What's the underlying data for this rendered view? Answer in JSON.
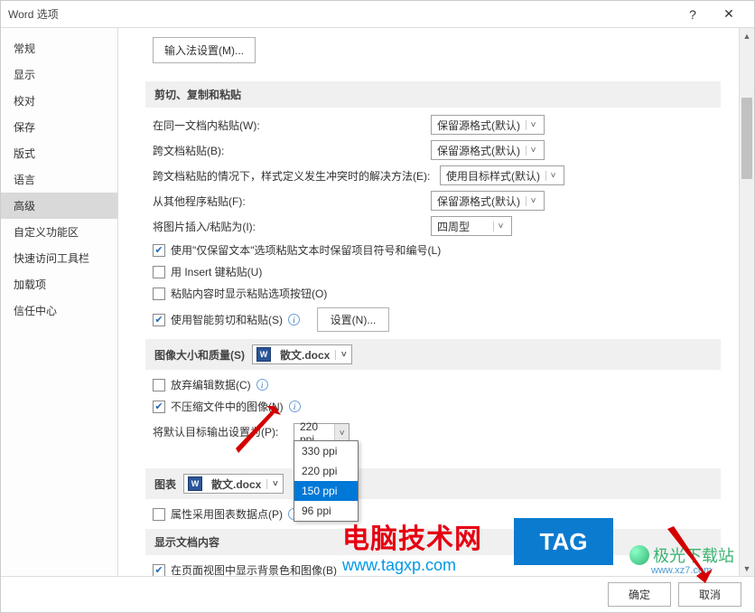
{
  "titlebar": {
    "title": "Word 选项",
    "help": "?",
    "close": "✕"
  },
  "sidebar": {
    "items": [
      {
        "label": "常规"
      },
      {
        "label": "显示"
      },
      {
        "label": "校对"
      },
      {
        "label": "保存"
      },
      {
        "label": "版式"
      },
      {
        "label": "语言"
      },
      {
        "label": "高级",
        "selected": true
      },
      {
        "label": "自定义功能区"
      },
      {
        "label": "快速访问工具栏"
      },
      {
        "label": "加载项"
      },
      {
        "label": "信任中心"
      }
    ]
  },
  "content": {
    "ime_btn": "输入法设置(M)...",
    "section_cut": "剪切、复制和粘贴",
    "paste_same_label": "在同一文档内粘贴(W):",
    "paste_same_value": "保留源格式(默认)",
    "paste_cross_label": "跨文档粘贴(B):",
    "paste_cross_value": "保留源格式(默认)",
    "paste_conflict_label": "跨文档粘贴的情况下，样式定义发生冲突时的解决方法(E):",
    "paste_conflict_value": "使用目标样式(默认)",
    "paste_other_label": "从其他程序粘贴(F):",
    "paste_other_value": "保留源格式(默认)",
    "paste_img_label": "将图片插入/粘贴为(I):",
    "paste_img_value": "四周型",
    "cb_keep_bullets": "使用\"仅保留文本\"选项粘贴文本时保留项目符号和编号(L)",
    "cb_insert_key": "用 Insert 键粘贴(U)",
    "cb_show_paste_btn": "粘贴内容时显示粘贴选项按钮(O)",
    "cb_smart_cut": "使用智能剪切和粘贴(S)",
    "settings_btn": "设置(N)...",
    "section_image": "图像大小和质量(S)",
    "doc_name": "散文.docx",
    "cb_discard_edit": "放弃编辑数据(C)",
    "cb_no_compress": "不压缩文件中的图像(N)",
    "default_output_label": "将默认目标输出设置为(P):",
    "ppi_value": "220 ppi",
    "ppi_options": [
      "330 ppi",
      "220 ppi",
      "150 ppi",
      "96 ppi"
    ],
    "section_chart": "图表",
    "cb_chart_ref": "属性采用图表数据点(P)",
    "section_display": "显示文档内容",
    "cb_page_bg": "在页面视图中显示背景色和图像(B)"
  },
  "footer": {
    "ok": "确定",
    "cancel": "取消"
  },
  "watermark": {
    "text1": "电脑技术网",
    "url": "www.tagxp.com",
    "tag": "TAG",
    "logo": "极光下载站",
    "logo_sub": "www.xz7.com"
  }
}
